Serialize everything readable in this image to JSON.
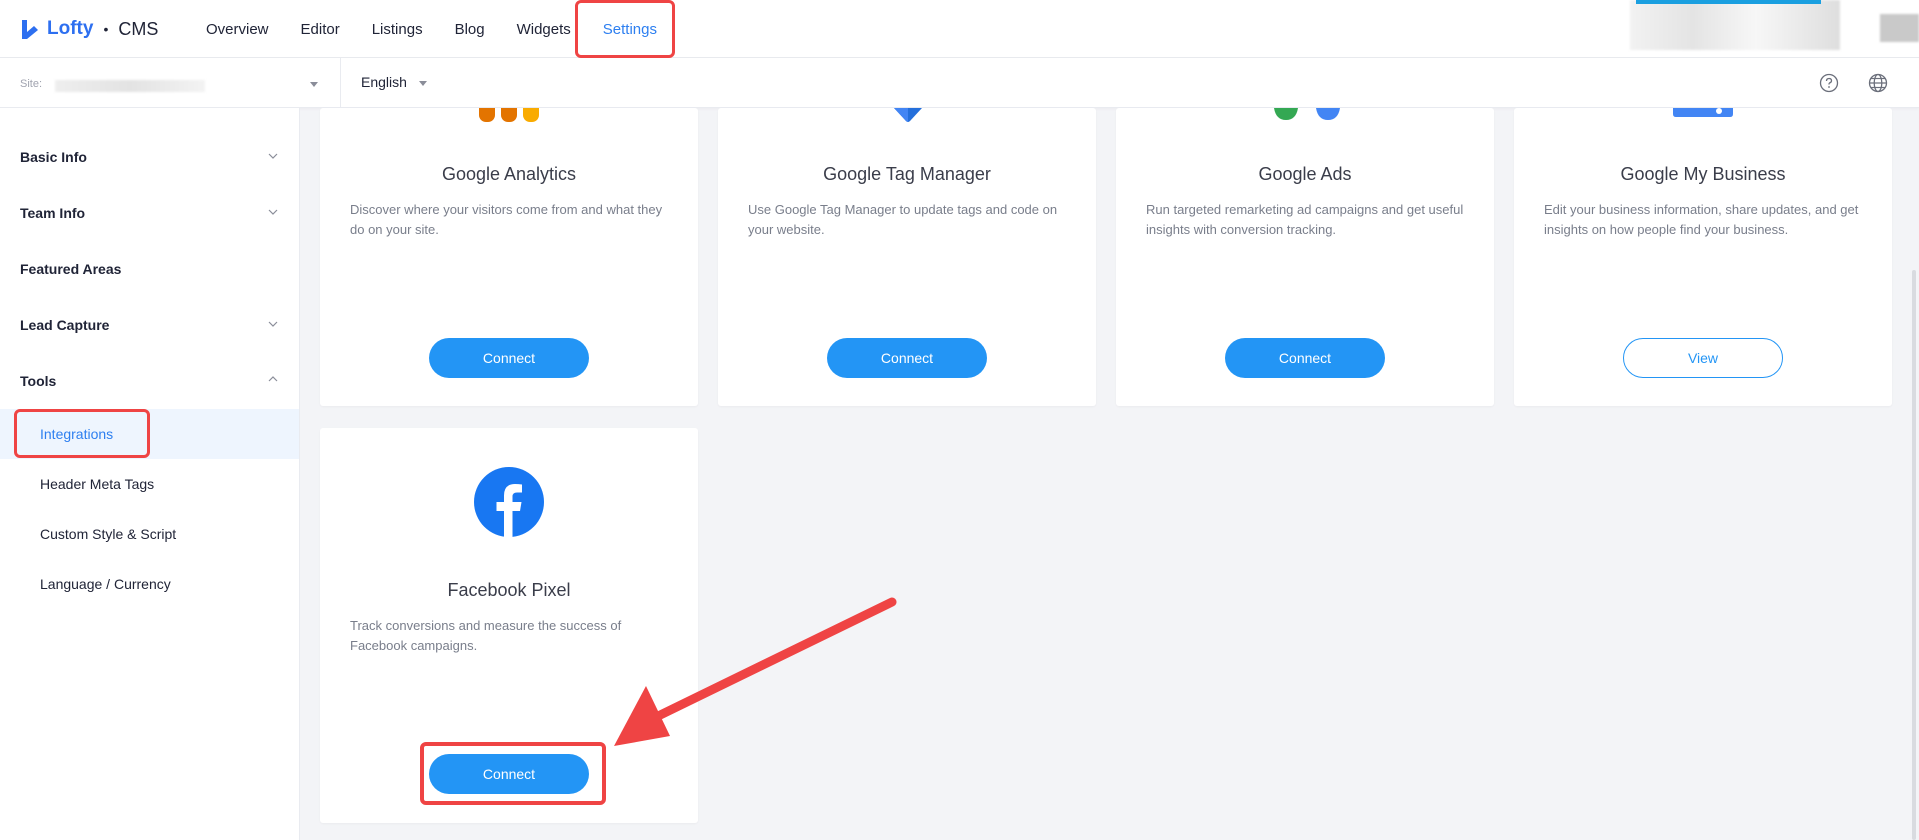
{
  "brand": {
    "name": "Lofty",
    "separator": "•",
    "product": "CMS",
    "accent": "#2d7ff0"
  },
  "nav": {
    "items": [
      {
        "label": "Overview"
      },
      {
        "label": "Editor"
      },
      {
        "label": "Listings"
      },
      {
        "label": "Blog"
      },
      {
        "label": "Widgets"
      },
      {
        "label": "Settings",
        "active": true
      }
    ]
  },
  "subbar": {
    "site_label": "Site:",
    "language": "English"
  },
  "sidebar": {
    "sections": [
      {
        "label": "Basic Info",
        "chevron": "down"
      },
      {
        "label": "Team Info",
        "chevron": "down"
      },
      {
        "label": "Featured Areas"
      },
      {
        "label": "Lead Capture",
        "chevron": "down"
      },
      {
        "label": "Tools",
        "chevron": "up"
      }
    ],
    "tools": [
      {
        "label": "Integrations",
        "active": true
      },
      {
        "label": "Header Meta Tags"
      },
      {
        "label": "Custom Style & Script"
      },
      {
        "label": "Language / Currency"
      }
    ]
  },
  "cards": [
    {
      "title": "Google Analytics",
      "description": "Discover where your visitors come from and what they do on your site.",
      "button": "Connect",
      "icon": "google-analytics-icon"
    },
    {
      "title": "Google Tag Manager",
      "description": "Use Google Tag Manager to update tags and code on your website.",
      "button": "Connect",
      "icon": "google-tag-manager-icon"
    },
    {
      "title": "Google Ads",
      "description": "Run targeted remarketing ad campaigns and get useful insights with conversion tracking.",
      "button": "Connect",
      "icon": "google-ads-icon"
    },
    {
      "title": "Google My Business",
      "description": "Edit your business information, share updates, and get insights on how people find your business.",
      "button": "View",
      "icon": "google-my-business-icon"
    },
    {
      "title": "Facebook Pixel",
      "description": "Track conversions and measure the success of Facebook campaigns.",
      "button": "Connect",
      "icon": "facebook-icon"
    }
  ],
  "colors": {
    "primary_button": "#2395f5",
    "highlight": "#ef4444",
    "facebook": "#1877f2"
  }
}
